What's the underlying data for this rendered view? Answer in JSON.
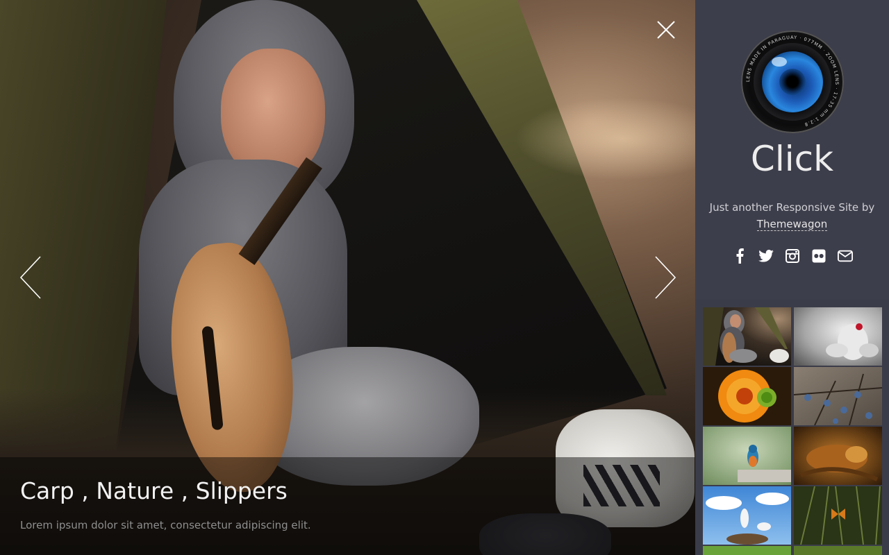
{
  "viewer": {
    "caption_title": "Carp , Nature , Slippers",
    "caption_text": "Lorem ipsum dolor sit amet, consectetur adipiscing elit."
  },
  "sidebar": {
    "brand": "Click",
    "tagline": "Just another Responsive Site by",
    "tagline_link": "Themewagon",
    "logo_ring_text": "LENS MADE IN PARAGUAY · 077MM · ZOOM LENS · 17-35 mm 1:2.8",
    "socials": [
      "facebook-icon",
      "twitter-icon",
      "instagram-icon",
      "flickr-icon",
      "envelope-icon"
    ]
  },
  "thumbnails": [
    {
      "name": "boy-guitar-tent",
      "active": true
    },
    {
      "name": "ladybug-flower",
      "active": false
    },
    {
      "name": "orange-gerbera",
      "active": false
    },
    {
      "name": "berries-branch",
      "active": false
    },
    {
      "name": "kingfisher",
      "active": false
    },
    {
      "name": "iguana",
      "active": false
    },
    {
      "name": "storks-nest",
      "active": false
    },
    {
      "name": "butterfly-grass",
      "active": false
    },
    {
      "name": "green-field",
      "active": false
    },
    {
      "name": "green-leaves",
      "active": false
    }
  ],
  "colors": {
    "sidebar_bg": "#3b3c49",
    "accent_text": "#ededed"
  }
}
